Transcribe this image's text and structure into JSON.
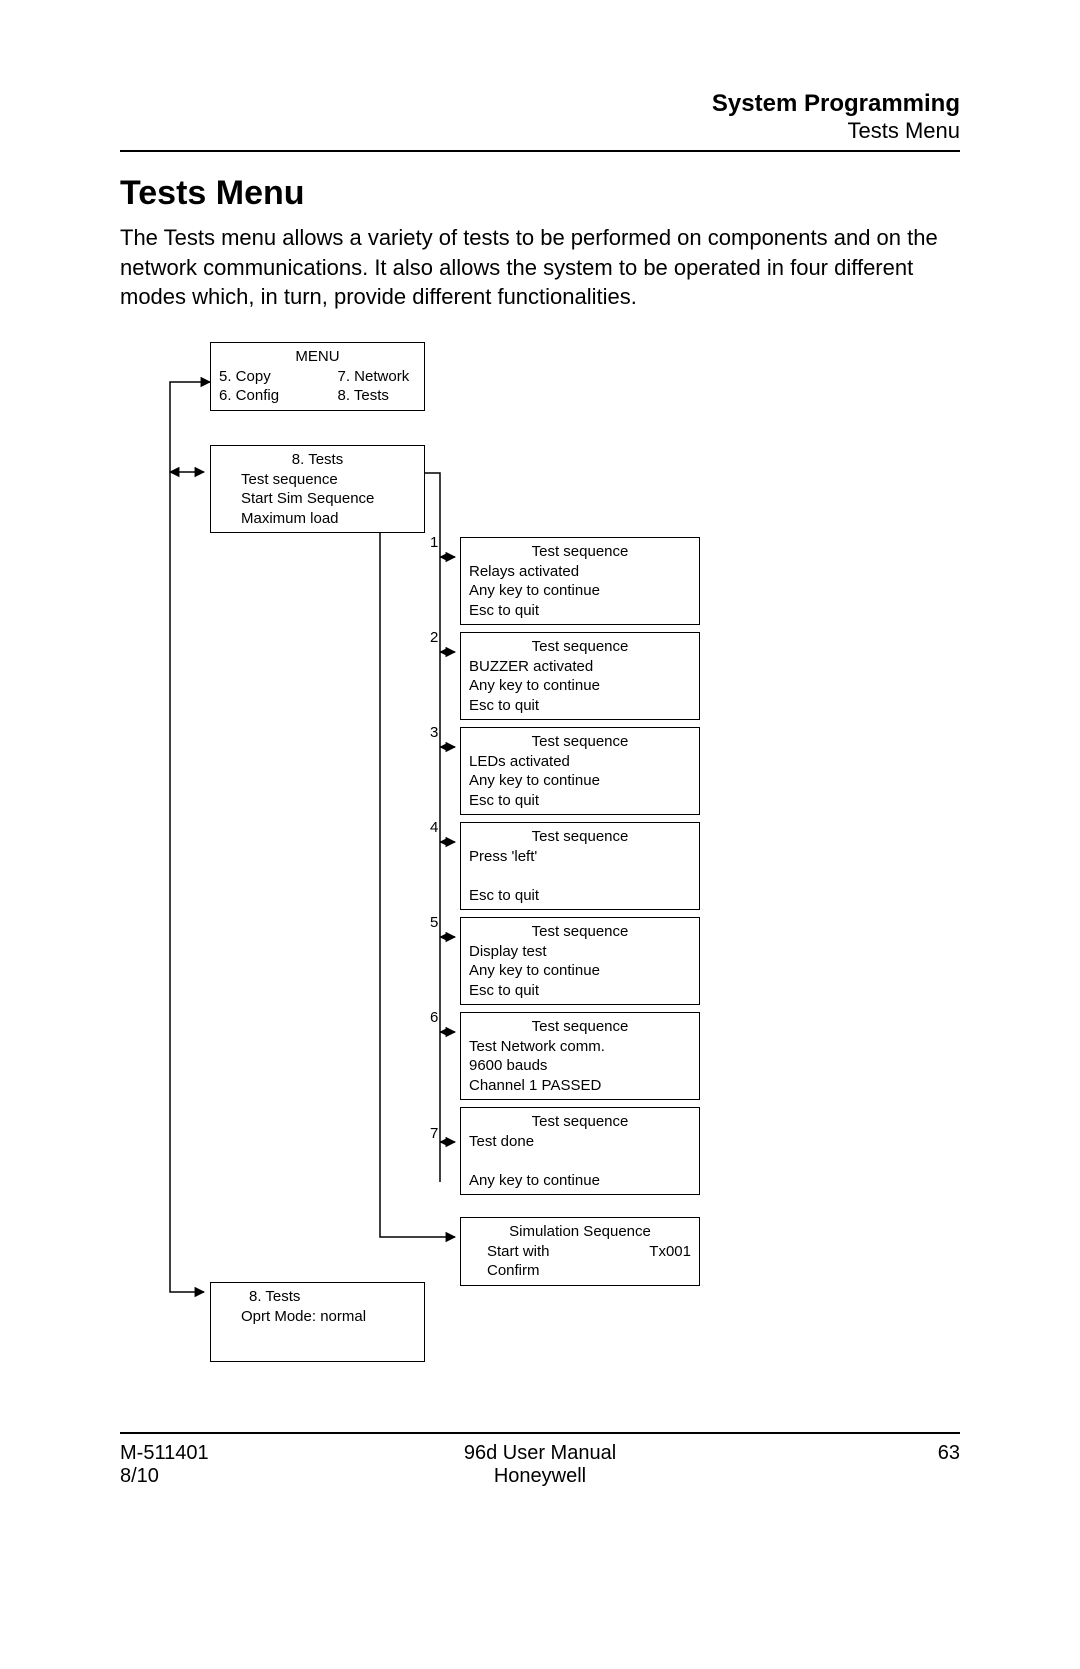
{
  "header": {
    "title": "System Programming",
    "subtitle": "Tests Menu"
  },
  "main": {
    "heading": "Tests Menu",
    "intro": "The Tests menu allows a variety of tests to be performed on components and on the network communications.  It also allows the system to be operated in four different modes which, in turn, provide different functionalities."
  },
  "diagram": {
    "menu_box": {
      "title": "MENU",
      "col1a": "5. Copy",
      "col1b": "6. Config",
      "col2a": "7. Network",
      "col2b": "8. Tests"
    },
    "tests_box": {
      "title": "8. Tests",
      "l1": "Test sequence",
      "l2": "Start Sim Sequence",
      "l3": "Maximum load"
    },
    "seq": [
      {
        "num": "1",
        "title": "Test sequence",
        "l1": "Relays activated",
        "l2": "Any key to continue",
        "l3": "Esc to quit"
      },
      {
        "num": "2",
        "title": "Test sequence",
        "l1": "BUZZER activated",
        "l2": "Any key to continue",
        "l3": "Esc to quit"
      },
      {
        "num": "3",
        "title": "Test sequence",
        "l1": "LEDs activated",
        "l2": "Any key to continue",
        "l3": "Esc to quit"
      },
      {
        "num": "4",
        "title": "Test sequence",
        "l1": "Press 'left'",
        "l2": " ",
        "l3": "Esc to quit"
      },
      {
        "num": "5",
        "title": "Test sequence",
        "l1": "Display test",
        "l2": "Any key to continue",
        "l3": "Esc to quit"
      },
      {
        "num": "6",
        "title": "Test sequence",
        "l1": "Test Network comm.",
        "l2": "9600 bauds",
        "l3": "Channel 1 PASSED"
      },
      {
        "num": "7",
        "title": "Test sequence",
        "l1": "Test done",
        "l2": " ",
        "l3": "Any key to continue"
      }
    ],
    "sim_box": {
      "title": "Simulation Sequence",
      "l1a": "Start with",
      "l1b": "Tx001",
      "l2": "Confirm"
    },
    "mode_box": {
      "title": "8. Tests",
      "l1": "Oprt Mode: normal"
    }
  },
  "footer": {
    "left1": "M-511401",
    "left2": "8/10",
    "center1": "96d User Manual",
    "center2": "Honeywell",
    "right": "63"
  }
}
